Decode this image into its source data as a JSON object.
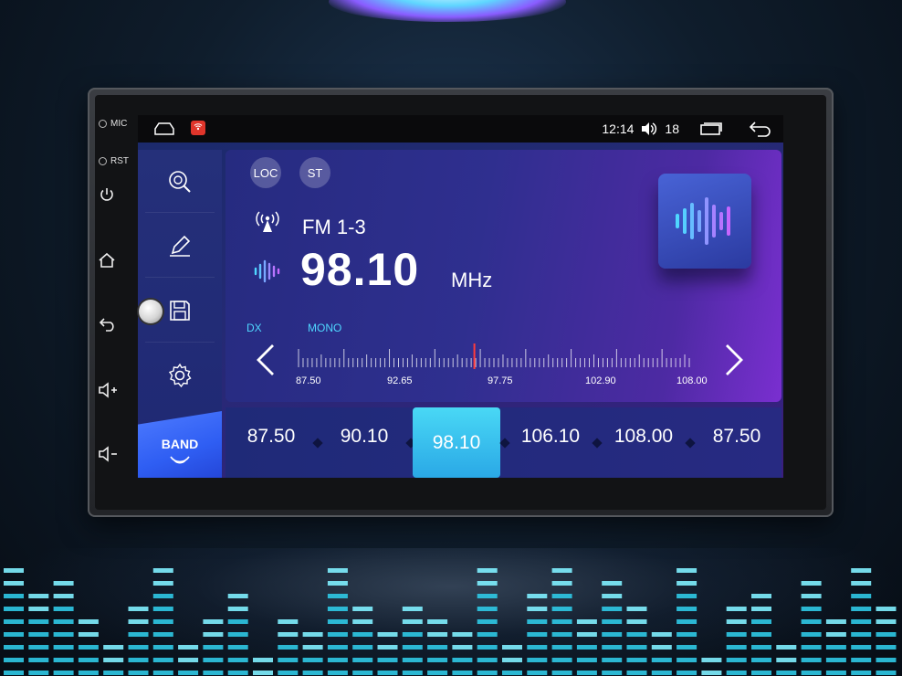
{
  "device": {
    "side_labels": {
      "mic": "MIC",
      "rst": "RST"
    }
  },
  "statusbar": {
    "time": "12:14",
    "volume": "18"
  },
  "radio": {
    "loc_label": "LOC",
    "st_label": "ST",
    "band": "FM 1-3",
    "frequency": "98.10",
    "unit": "MHz",
    "dx_label": "DX",
    "mono_label": "MONO",
    "scale_labels": [
      "87.50",
      "92.65",
      "97.75",
      "102.90",
      "108.00"
    ],
    "tuner_position": 0.45
  },
  "leftnav": {
    "band_label": "BAND"
  },
  "presets": [
    "87.50",
    "90.10",
    "98.10",
    "106.10",
    "108.00",
    "87.50"
  ],
  "active_preset_index": 2,
  "colors": {
    "accent": "#4fd7ff",
    "preset_active": "#3cc4ee",
    "tuner_marker": "#ff3b3b"
  }
}
